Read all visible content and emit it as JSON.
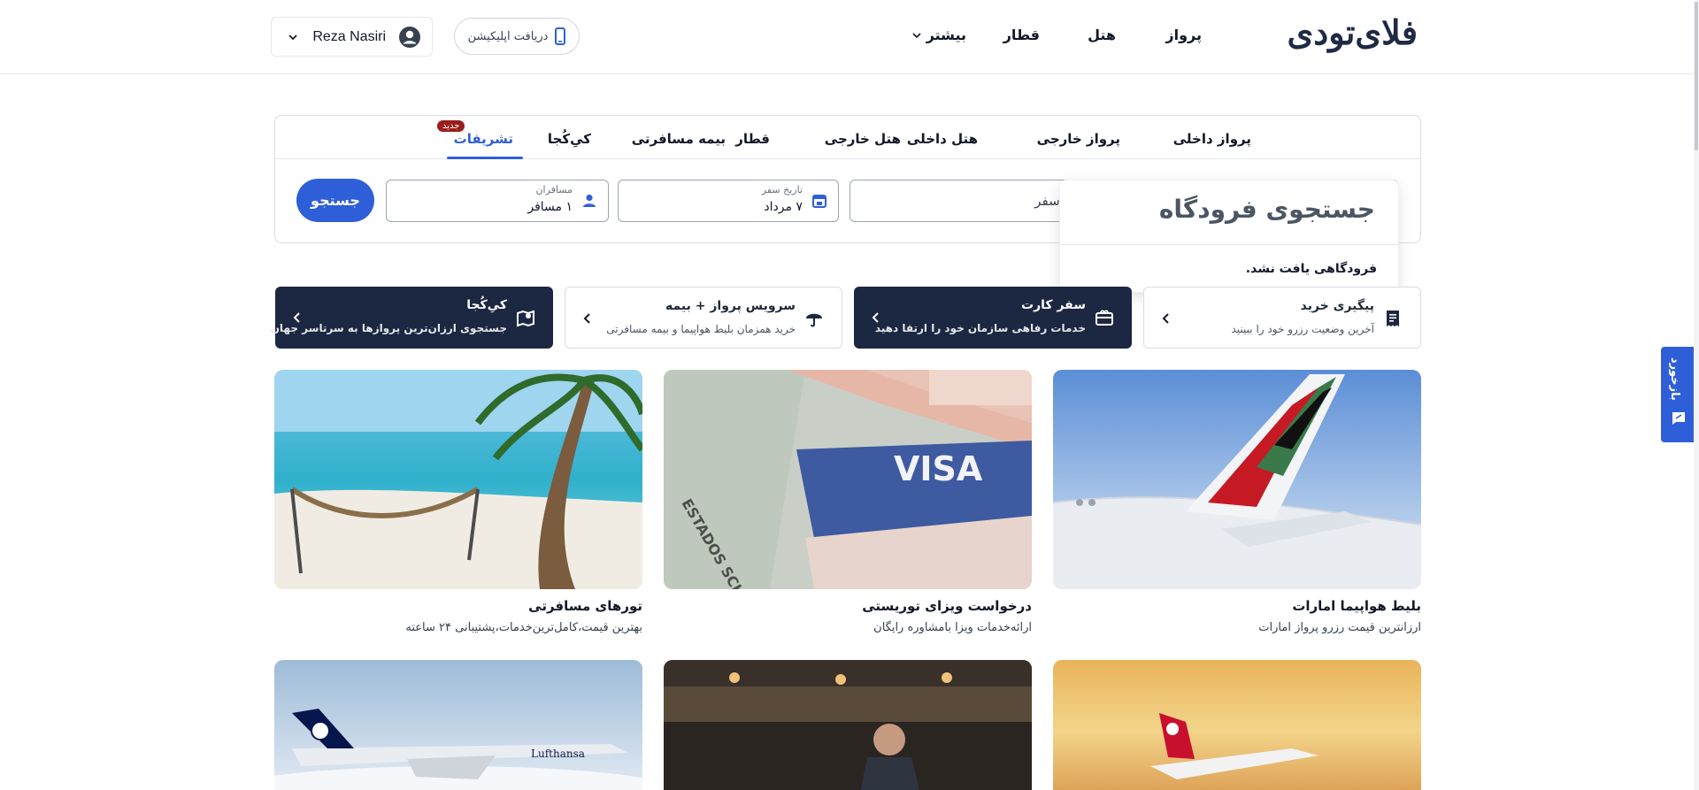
{
  "brand": {
    "logo_text": "فلای‌تودی"
  },
  "header": {
    "nav": {
      "flight": "پرواز",
      "hotel": "هتل",
      "train": "قطار",
      "more": "بیشتر"
    },
    "app_button_label": "دریافت اپلیکیشن",
    "user_name": "Reza Nasiri"
  },
  "search": {
    "tabs": [
      {
        "label": "پرواز داخلی"
      },
      {
        "label": "پرواز خارجی"
      },
      {
        "label": "هتل داخلی"
      },
      {
        "label": "هتل خارجی"
      },
      {
        "label": "قطار"
      },
      {
        "label": "بیمه مسافرتی"
      },
      {
        "label": "کیِ‌کُجا"
      },
      {
        "label": "تشریفات",
        "active": true,
        "badge": "جدید"
      }
    ],
    "type_field_value": "پرواز / نوع سفر",
    "date_field": {
      "label": "تاریخ سفر",
      "value": "۷ مرداد"
    },
    "passengers_field": {
      "label": "مسافران",
      "value": "۱ مسافر"
    },
    "search_button_label": "جستجو"
  },
  "airport_popup": {
    "title": "جستجوی فرودگاه",
    "message": "فرودگاهی یافت نشد."
  },
  "services": [
    {
      "title": "پیگیری خرید",
      "desc": "آخرین وضعیت رزرو خود را ببینید",
      "icon": "receipt-icon",
      "style": "light"
    },
    {
      "title": "سفر کارت",
      "desc": "خدمات رفاهی سازمان خود را ارتقا دهید",
      "icon": "gift-card-icon",
      "style": "dark"
    },
    {
      "title": "سرویس پرواز + بیمه",
      "desc": "خرید همزمان بلیط هواپیما و بیمه مسافرتی",
      "icon": "umbrella-icon",
      "style": "light"
    },
    {
      "title": "کیِ‌کُجا",
      "desc": "جستجوی ارزان‌ترین پروازها به سرتاسر جهان",
      "icon": "map-pin-icon",
      "style": "dark"
    }
  ],
  "promos": [
    {
      "title": "بلیط هواپیما امارات",
      "desc": "ارزانترین قیمت رزرو پرواز امارات"
    },
    {
      "title": "درخواست ویزای توریستی",
      "desc": "ارائه‌خدمات ویزا بامشاوره رایگان"
    },
    {
      "title": "تورهای مسافرتی",
      "desc": "بهترین قیمت،کامل‌ترین‌خدمات،پشتیبانی ۲۴ ساعته"
    },
    {
      "title": "",
      "desc": ""
    },
    {
      "title": "",
      "desc": ""
    },
    {
      "title": "",
      "desc": ""
    }
  ],
  "promo_image_text": {
    "visa_word": "VISA",
    "schengen_word": "ESTADOS SCHENGEN",
    "airline_word": "Lufthansa"
  },
  "feedback_tab": {
    "label": "بازخورد"
  },
  "colors": {
    "primary": "#2f5fd8",
    "dark_card": "#1c2742",
    "badge": "#9b1c1c"
  }
}
